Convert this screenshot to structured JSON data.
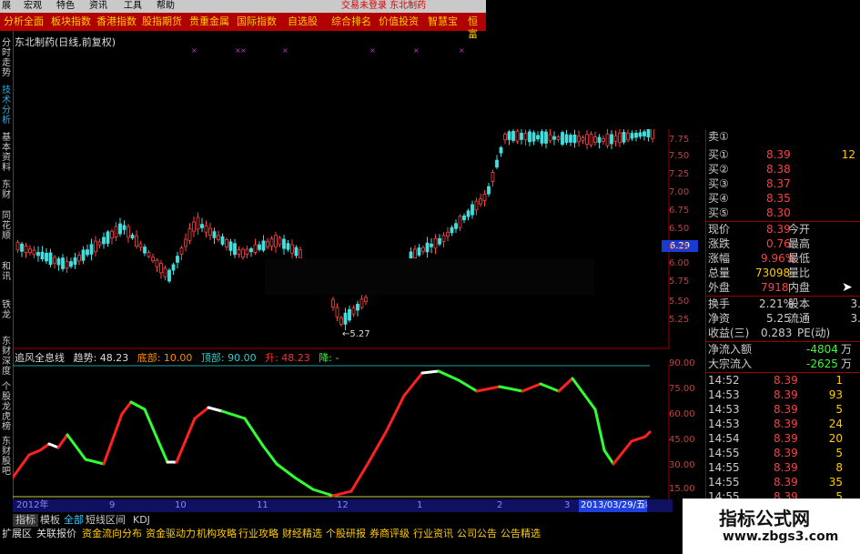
{
  "menubar": {
    "items": [
      "展",
      "宏观",
      "特色",
      "资讯",
      "工具",
      "帮助"
    ],
    "title": "交易未登录 东北制药"
  },
  "toolbar": {
    "items": [
      "分析全面",
      "板块指数",
      "香港指数",
      "股指期货",
      "贵重金属",
      "国际指数",
      "自选股",
      "综合排名",
      "价值投资",
      "智慧宝",
      "恒富"
    ]
  },
  "side_tabs": [
    "分时走势",
    "技术分析",
    "基本资料",
    "东财",
    "同花顺",
    "和讯",
    "铁龙",
    "东财深度",
    "个股龙虎榜",
    "东财股吧"
  ],
  "chart": {
    "title": "东北制药(日线,前复权)",
    "low_label": "5.27",
    "current_price_tag": "6.29",
    "y_axis": [
      "7.75",
      "7.50",
      "7.25",
      "7.00",
      "6.75",
      "6.50",
      "6.25",
      "6.00",
      "5.75",
      "5.50",
      "5.25"
    ]
  },
  "indicator": {
    "name": "追风全息线",
    "trend_label": "趋势: 48.23",
    "bottom_label": "底部: 10.00",
    "top_label": "顶部: 90.00",
    "rise_label": "升: 48.23",
    "fall_label": "降: -",
    "y_axis": [
      "90.00",
      "75.00",
      "60.00",
      "45.00",
      "30.00",
      "15.00"
    ]
  },
  "date_bar": {
    "labels": [
      "2012年",
      "9",
      "10",
      "11",
      "12",
      "1",
      "2",
      "3"
    ],
    "cursor_date": "2013/03/29/五",
    "cursor_right": "4"
  },
  "bottom_tabs": [
    "指标",
    "模板",
    "全部",
    "短线区间",
    "KDJ"
  ],
  "bottom_links": [
    "扩展区",
    "关联报价",
    "资金流向分布",
    "资金驱动力",
    "机构攻略",
    "行业攻略",
    "财经精选",
    "个股研报",
    "券商评级",
    "行业资讯",
    "公司公告",
    "公告精选"
  ],
  "quote": {
    "order_book": [
      {
        "label": "卖①",
        "price": "",
        "vol": ""
      },
      {
        "label": "买①",
        "price": "8.39",
        "vol": "12"
      },
      {
        "label": "买②",
        "price": "8.38",
        "vol": ""
      },
      {
        "label": "买③",
        "price": "8.37",
        "vol": ""
      },
      {
        "label": "买④",
        "price": "8.35",
        "vol": ""
      },
      {
        "label": "买⑤",
        "price": "8.30",
        "vol": ""
      }
    ],
    "stats": [
      {
        "l1": "现价",
        "v1": "8.39",
        "l2": "今开",
        "v2": ""
      },
      {
        "l1": "涨跌",
        "v1": "0.76",
        "l2": "最高",
        "v2": ""
      },
      {
        "l1": "涨幅",
        "v1": "9.96%",
        "l2": "最低",
        "v2": ""
      },
      {
        "l1": "总量",
        "v1": "73098",
        "l2": "量比",
        "v2": ""
      },
      {
        "l1": "外盘",
        "v1": "7918",
        "l2": "内盘",
        "v2": ""
      }
    ],
    "stats2": [
      {
        "l1": "换手",
        "v1": "2.21%",
        "l2": "股本",
        "v2": "3."
      },
      {
        "l1": "净资",
        "v1": "5.25",
        "l2": "流通",
        "v2": "3."
      },
      {
        "l1": "收益(三)",
        "v1": "0.283",
        "l2": "PE(动)",
        "v2": ""
      }
    ],
    "flows": [
      {
        "label": "净流入额",
        "value": "-4804",
        "unit": "万"
      },
      {
        "label": "大宗流入",
        "value": "-2625",
        "unit": "万"
      }
    ],
    "ticks": [
      {
        "time": "14:52",
        "price": "8.39",
        "vol": "1"
      },
      {
        "time": "14:53",
        "price": "8.39",
        "vol": "93"
      },
      {
        "time": "14:53",
        "price": "8.39",
        "vol": "5"
      },
      {
        "time": "14:53",
        "price": "8.39",
        "vol": "24"
      },
      {
        "time": "14:54",
        "price": "8.39",
        "vol": "20"
      },
      {
        "time": "14:55",
        "price": "8.39",
        "vol": "5"
      },
      {
        "time": "14:55",
        "price": "8.39",
        "vol": "8"
      },
      {
        "time": "14:55",
        "price": "8.39",
        "vol": "35"
      },
      {
        "time": "14:55",
        "price": "8.39",
        "vol": "5"
      }
    ]
  },
  "watermark": {
    "line1": "指标公式网",
    "line2": "www.zbgs3.com"
  },
  "colors": {
    "up": "#ff4040",
    "down": "#40e0e0",
    "line_up": "#ff2020",
    "line_down": "#30ff30",
    "line_flat": "#ffffff"
  }
}
